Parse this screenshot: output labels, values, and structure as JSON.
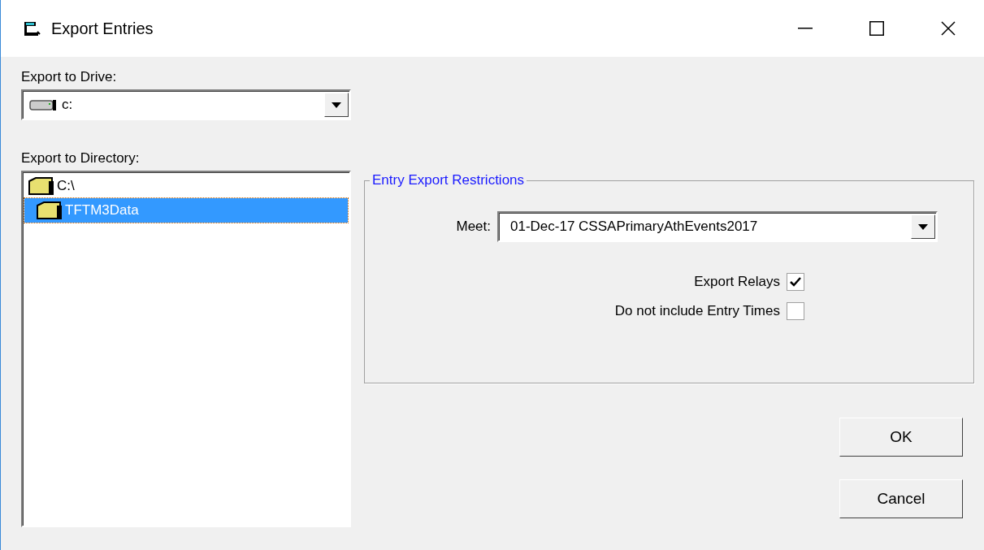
{
  "window": {
    "title": "Export Entries"
  },
  "drive": {
    "label": "Export to Drive:",
    "value": "c:"
  },
  "directory": {
    "label": "Export to Directory:",
    "items": [
      {
        "label": "C:\\",
        "selected": false,
        "children": [
          {
            "label": "TFTM3Data",
            "selected": true
          }
        ]
      }
    ]
  },
  "restrictions": {
    "title": "Entry Export Restrictions",
    "meet": {
      "label": "Meet:",
      "value": "01-Dec-17 CSSAPrimaryAthEvents2017"
    },
    "options": [
      {
        "label": "Export Relays",
        "checked": true
      },
      {
        "label": "Do not include Entry Times",
        "checked": false
      }
    ]
  },
  "buttons": [
    "OK",
    "Cancel"
  ]
}
